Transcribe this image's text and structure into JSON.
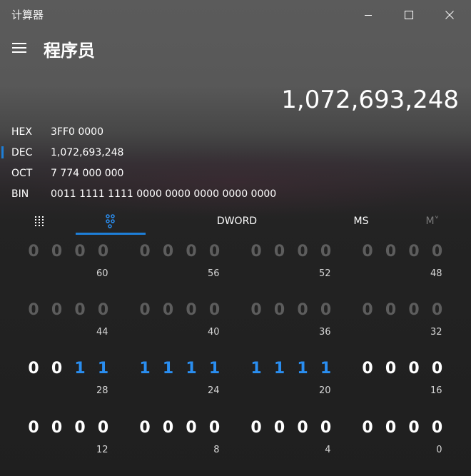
{
  "window": {
    "title": "计算器"
  },
  "header": {
    "mode_title": "程序员"
  },
  "display": {
    "value": "1,072,693,248"
  },
  "radix": [
    {
      "label": "HEX",
      "value": "3FF0 0000",
      "selected": false
    },
    {
      "label": "DEC",
      "value": "1,072,693,248",
      "selected": true
    },
    {
      "label": "OCT",
      "value": "7 774 000 000",
      "selected": false
    },
    {
      "label": "BIN",
      "value": "0011 1111 1111 0000 0000 0000 0000 0000",
      "selected": false
    }
  ],
  "tabs": {
    "word_size": "DWORD",
    "ms": "MS",
    "mr": "M˅"
  },
  "bit_rows": [
    {
      "labels": [
        "60",
        "56",
        "52",
        "48"
      ],
      "groups": [
        [
          "0",
          "0",
          "0",
          "0"
        ],
        [
          "0",
          "0",
          "0",
          "0"
        ],
        [
          "0",
          "0",
          "0",
          "0"
        ],
        [
          "0",
          "0",
          "0",
          "0"
        ]
      ],
      "enabled": false
    },
    {
      "labels": [
        "44",
        "40",
        "36",
        "32"
      ],
      "groups": [
        [
          "0",
          "0",
          "0",
          "0"
        ],
        [
          "0",
          "0",
          "0",
          "0"
        ],
        [
          "0",
          "0",
          "0",
          "0"
        ],
        [
          "0",
          "0",
          "0",
          "0"
        ]
      ],
      "enabled": false
    },
    {
      "labels": [
        "28",
        "24",
        "20",
        "16"
      ],
      "groups": [
        [
          "0",
          "0",
          "1",
          "1"
        ],
        [
          "1",
          "1",
          "1",
          "1"
        ],
        [
          "1",
          "1",
          "1",
          "1"
        ],
        [
          "0",
          "0",
          "0",
          "0"
        ]
      ],
      "enabled": true
    },
    {
      "labels": [
        "12",
        "8",
        "4",
        "0"
      ],
      "groups": [
        [
          "0",
          "0",
          "0",
          "0"
        ],
        [
          "0",
          "0",
          "0",
          "0"
        ],
        [
          "0",
          "0",
          "0",
          "0"
        ],
        [
          "0",
          "0",
          "0",
          "0"
        ]
      ],
      "enabled": true
    }
  ],
  "colors": {
    "accent": "#1e7fd8",
    "bit_on": "#2a8ef0",
    "bit_disabled": "#5d5d5d"
  }
}
